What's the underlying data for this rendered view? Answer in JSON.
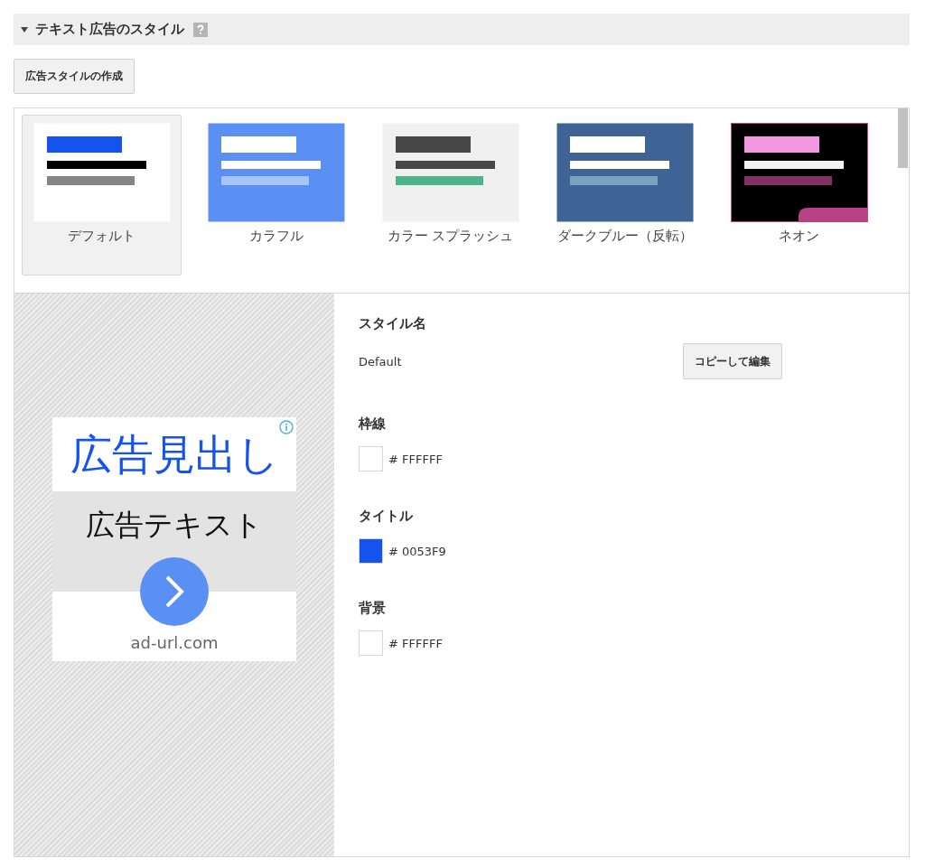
{
  "section": {
    "title": "テキスト広告のスタイル",
    "expanded": true
  },
  "create_button": "広告スタイルの作成",
  "styles": [
    {
      "label": "デフォルト",
      "kind": "default",
      "selected": true
    },
    {
      "label": "カラフル",
      "kind": "colorful",
      "selected": false
    },
    {
      "label": "カラー スプラッシュ",
      "kind": "splash",
      "selected": false
    },
    {
      "label": "ダークブルー（反転）",
      "kind": "darkblue",
      "selected": false
    },
    {
      "label": "ネオン",
      "kind": "neon",
      "selected": false
    }
  ],
  "preview": {
    "headline": "広告見出し",
    "text": "広告テキスト",
    "url": "ad-url.com"
  },
  "form": {
    "name_label": "スタイル名",
    "name_value": "Default",
    "copy_button": "コピーして編集",
    "colors": [
      {
        "label": "枠線",
        "value": "# FFFFFF",
        "color": "#ffffff"
      },
      {
        "label": "タイトル",
        "value": "# 0053F9",
        "color": "#1553f0"
      },
      {
        "label": "背景",
        "value": "# FFFFFF",
        "color": "#ffffff"
      }
    ]
  }
}
